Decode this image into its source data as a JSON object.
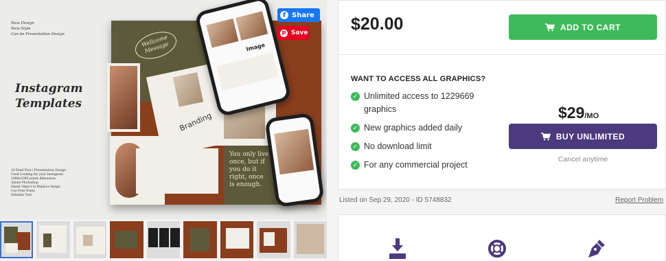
{
  "preview": {
    "side_text_lines": [
      "New Design",
      "New Style",
      "Can be Presentation Design"
    ],
    "title_line1": "Instagram",
    "title_line2": "Templates",
    "feature_list": [
      "10 Feed Post / Presentation Design",
      "Used Looking for your Instagram",
      "1080x1080 pixels dimension",
      "Adobe Photoshop",
      "Smart Object to Replace Image",
      "Use Free Fonts",
      "Editable Text"
    ],
    "wellcome_text": "Wellcome Message",
    "branding_text": "Branding",
    "quote_text": "You only live once, but if you do it right, once is enough.",
    "phone_label": "Image",
    "share_label": "Share",
    "save_label": "Save"
  },
  "pricing": {
    "price": "$20.00",
    "add_to_cart_label": "ADD TO CART",
    "want_heading": "WANT TO ACCESS ALL GRAPHICS?",
    "features": [
      "Unlimited access to 1229669 graphics",
      "New graphics added daily",
      "No download limit",
      "For any commercial project"
    ],
    "unlimited_price": "$29",
    "unlimited_period": "/MO",
    "buy_unlimited_label": "BUY UNLIMITED",
    "cancel_text": "Cancel anytime"
  },
  "meta": {
    "listed_text": "Listed on Sep 29, 2020 - ID 5748832",
    "report_text": "Report Problem"
  },
  "icons": {
    "download": "download-icon",
    "support": "lifebuoy-icon",
    "design": "pen-nib-icon"
  },
  "colors": {
    "green": "#3fba5b",
    "purple": "#4c3a7e",
    "facebook": "#1877f2",
    "pinterest": "#e60023"
  }
}
